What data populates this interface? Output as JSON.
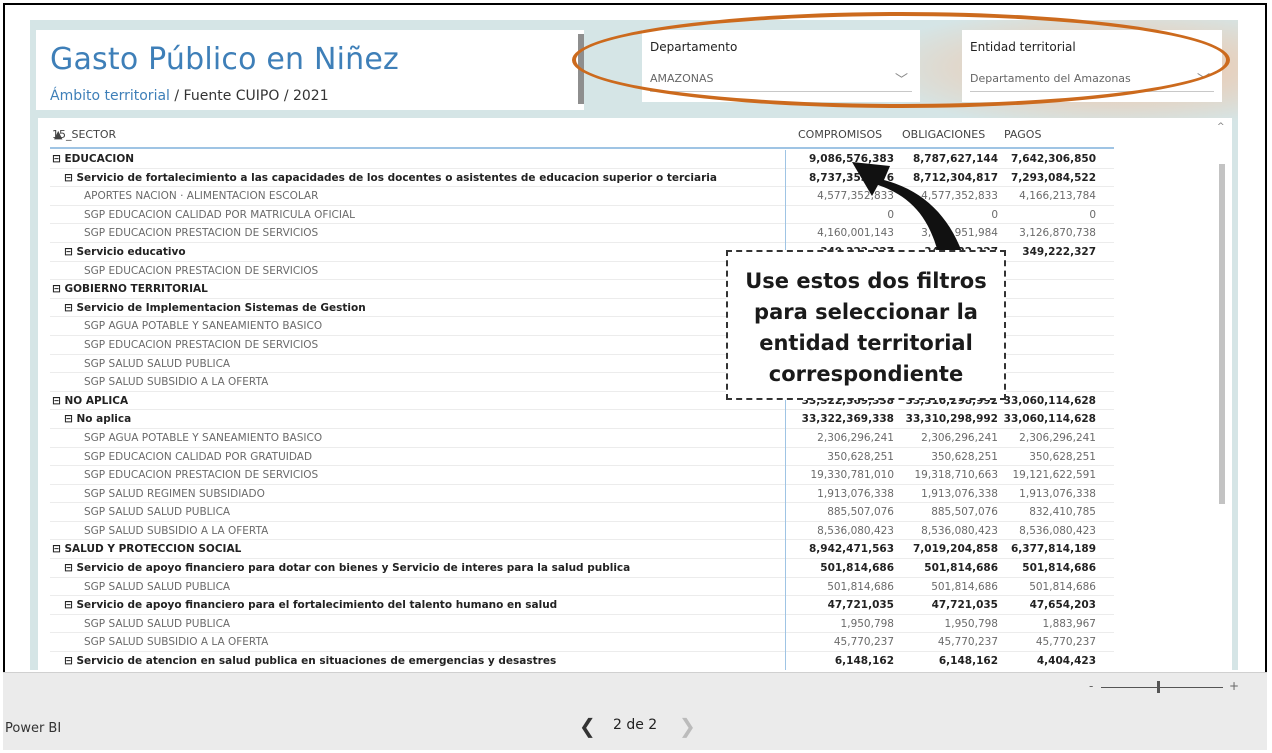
{
  "report": {
    "title": "Gasto Público en Niñez",
    "subtitle_link": "Ámbito territorial",
    "subtitle_rest": " / Fuente CUIPO / 2021"
  },
  "slicers": {
    "departamento": {
      "label": "Departamento",
      "value": "AMAZONAS"
    },
    "entidad": {
      "label": "Entidad territorial",
      "value": "Departamento del Amazonas"
    }
  },
  "matrix": {
    "headers": {
      "sector": "15_SECTOR",
      "c1": "COMPROMISOS",
      "c2": "OBLIGACIONES",
      "c3": "PAGOS"
    },
    "rows": [
      {
        "level": 0,
        "label": "⊟  EDUCACION",
        "c1": "9,086,576,383",
        "c2": "8,787,627,144",
        "c3": "7,642,306,850"
      },
      {
        "level": 1,
        "label": "⊟  Servicio de fortalecimiento a las capacidades de los docentes o asistentes de educacion superior o terciaria",
        "c1": "8,737,353,976",
        "c2": "8,712,304,817",
        "c3": "7,293,084,522"
      },
      {
        "level": 2,
        "label": "APORTES NACION · ALIMENTACION ESCOLAR",
        "c1": "4,577,352,833",
        "c2": "4,577,352,833",
        "c3": "4,166,213,784"
      },
      {
        "level": 2,
        "label": "SGP EDUCACION CALIDAD POR MATRICULA OFICIAL",
        "c1": "0",
        "c2": "0",
        "c3": "0"
      },
      {
        "level": 2,
        "label": "SGP EDUCACION PRESTACION DE SERVICIOS",
        "c1": "4,160,001,143",
        "c2": "3,934,951,984",
        "c3": "3,126,870,738"
      },
      {
        "level": 1,
        "label": "⊟  Servicio educativo",
        "c1": "349,222,327",
        "c2": "349,222,327",
        "c3": "349,222,327"
      },
      {
        "level": 2,
        "label": "SGP EDUCACION PRESTACION DE SERVICIOS",
        "c1": "",
        "c2": "",
        "c3": ""
      },
      {
        "level": 0,
        "label": "⊟  GOBIERNO TERRITORIAL",
        "c1": "",
        "c2": "",
        "c3": ""
      },
      {
        "level": 1,
        "label": "⊟  Servicio de Implementacion Sistemas de Gestion",
        "c1": "",
        "c2": "",
        "c3": ""
      },
      {
        "level": 2,
        "label": "SGP AGUA POTABLE Y SANEAMIENTO BASICO",
        "c1": "",
        "c2": "",
        "c3": ""
      },
      {
        "level": 2,
        "label": "SGP EDUCACION PRESTACION DE SERVICIOS",
        "c1": "",
        "c2": "",
        "c3": ""
      },
      {
        "level": 2,
        "label": "SGP SALUD SALUD PUBLICA",
        "c1": "",
        "c2": "",
        "c3": ""
      },
      {
        "level": 2,
        "label": "SGP SALUD SUBSIDIO A LA OFERTA",
        "c1": "",
        "c2": "",
        "c3": ""
      },
      {
        "level": 0,
        "label": "⊟  NO APLICA",
        "c1": "33,322,369,338",
        "c2": "33,310,298,992",
        "c3": "33,060,114,628"
      },
      {
        "level": 1,
        "label": "⊟  No aplica",
        "c1": "33,322,369,338",
        "c2": "33,310,298,992",
        "c3": "33,060,114,628"
      },
      {
        "level": 2,
        "label": "SGP AGUA POTABLE Y SANEAMIENTO BASICO",
        "c1": "2,306,296,241",
        "c2": "2,306,296,241",
        "c3": "2,306,296,241"
      },
      {
        "level": 2,
        "label": "SGP EDUCACION CALIDAD POR GRATUIDAD",
        "c1": "350,628,251",
        "c2": "350,628,251",
        "c3": "350,628,251"
      },
      {
        "level": 2,
        "label": "SGP EDUCACION PRESTACION DE SERVICIOS",
        "c1": "19,330,781,010",
        "c2": "19,318,710,663",
        "c3": "19,121,622,591"
      },
      {
        "level": 2,
        "label": "SGP SALUD REGIMEN SUBSIDIADO",
        "c1": "1,913,076,338",
        "c2": "1,913,076,338",
        "c3": "1,913,076,338"
      },
      {
        "level": 2,
        "label": "SGP SALUD SALUD PUBLICA",
        "c1": "885,507,076",
        "c2": "885,507,076",
        "c3": "832,410,785"
      },
      {
        "level": 2,
        "label": "SGP SALUD SUBSIDIO A LA OFERTA",
        "c1": "8,536,080,423",
        "c2": "8,536,080,423",
        "c3": "8,536,080,423"
      },
      {
        "level": 0,
        "label": "⊟  SALUD Y PROTECCION SOCIAL",
        "c1": "8,942,471,563",
        "c2": "7,019,204,858",
        "c3": "6,377,814,189"
      },
      {
        "level": 1,
        "label": "⊟  Servicio de apoyo financiero para dotar con bienes y Servicio de interes para la salud publica",
        "c1": "501,814,686",
        "c2": "501,814,686",
        "c3": "501,814,686"
      },
      {
        "level": 2,
        "label": "SGP SALUD SALUD PUBLICA",
        "c1": "501,814,686",
        "c2": "501,814,686",
        "c3": "501,814,686"
      },
      {
        "level": 1,
        "label": "⊟  Servicio de apoyo financiero para el fortalecimiento del talento humano en salud",
        "c1": "47,721,035",
        "c2": "47,721,035",
        "c3": "47,654,203"
      },
      {
        "level": 2,
        "label": "SGP SALUD SALUD PUBLICA",
        "c1": "1,950,798",
        "c2": "1,950,798",
        "c3": "1,883,967"
      },
      {
        "level": 2,
        "label": "SGP SALUD SUBSIDIO A LA OFERTA",
        "c1": "45,770,237",
        "c2": "45,770,237",
        "c3": "45,770,237"
      },
      {
        "level": 1,
        "label": "⊟  Servicio de atencion en salud publica en situaciones de emergencias y desastres",
        "c1": "6,148,162",
        "c2": "6,148,162",
        "c3": "4,404,423"
      }
    ]
  },
  "callout": {
    "text": "Use estos dos filtros para seleccionar la entidad territorial correspondiente"
  },
  "statusbar": {
    "brand": "Power BI",
    "page_label": "2 de 2",
    "prev_glyph": "❮",
    "next_glyph": "❯"
  },
  "colors": {
    "title_blue": "#3e7fb8",
    "annotation_orange": "#cc6a1d",
    "arrow_blue": "#4472c4",
    "canvas_bg": "#d5e5e6"
  }
}
